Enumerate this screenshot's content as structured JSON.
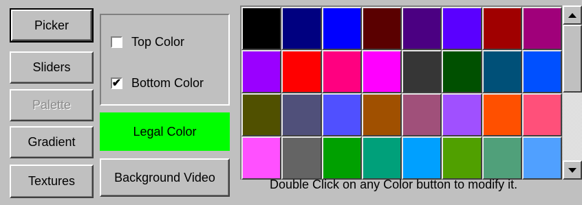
{
  "nav": {
    "picker": "Picker",
    "sliders": "Sliders",
    "palette": "Palette",
    "gradient": "Gradient",
    "textures": "Textures"
  },
  "options": {
    "top_color": {
      "label": "Top Color",
      "checked": false
    },
    "bottom_color": {
      "label": "Bottom Color",
      "checked": true
    }
  },
  "legal": {
    "label": "Legal Color",
    "color": "#00ff00"
  },
  "background_video": "Background Video",
  "hint": "Double Click on any Color button to modify it.",
  "palette": [
    [
      "#000000",
      "#000080",
      "#0000ff",
      "#5a0000",
      "#4b0082",
      "#5a00ff",
      "#a00000",
      "#a0007a"
    ],
    [
      "#9a00ff",
      "#ff0000",
      "#ff0080",
      "#ff00ff",
      "#363636",
      "#005000",
      "#005078",
      "#0050ff"
    ],
    [
      "#505000",
      "#50507a",
      "#5050ff",
      "#a05000",
      "#a0507a",
      "#a050ff",
      "#ff5000",
      "#ff507a"
    ],
    [
      "#ff50ff",
      "#646464",
      "#00a000",
      "#00a07a",
      "#00a0ff",
      "#50a000",
      "#50a07a",
      "#50a0ff"
    ]
  ]
}
